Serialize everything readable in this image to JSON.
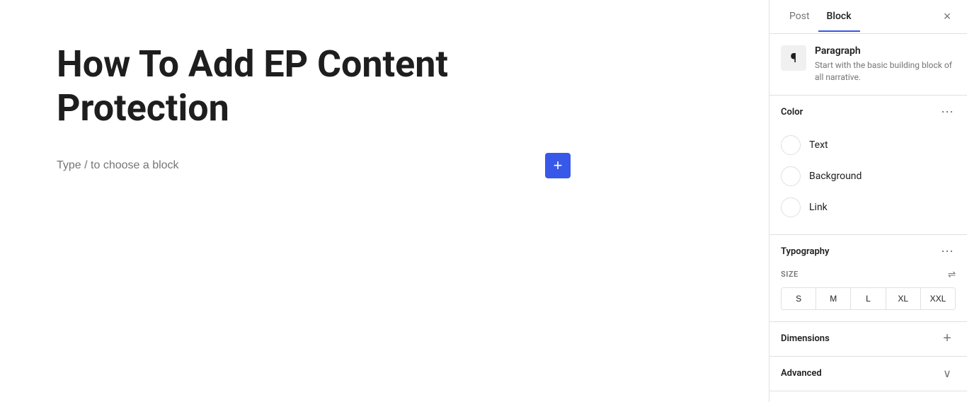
{
  "main": {
    "title": "How To Add EP Content Protection",
    "placeholder": "Type / to choose a block"
  },
  "sidebar": {
    "tabs": [
      {
        "label": "Post",
        "active": false
      },
      {
        "label": "Block",
        "active": true
      }
    ],
    "close_label": "×",
    "block_icon": "¶",
    "block_name": "Paragraph",
    "block_desc": "Start with the basic building block of all narrative.",
    "color_section": {
      "title": "Color",
      "options": [
        {
          "label": "Text"
        },
        {
          "label": "Background"
        },
        {
          "label": "Link"
        }
      ]
    },
    "typography_section": {
      "title": "Typography",
      "size_label": "SIZE",
      "sizes": [
        {
          "label": "S",
          "active": false
        },
        {
          "label": "M",
          "active": false
        },
        {
          "label": "L",
          "active": false
        },
        {
          "label": "XL",
          "active": false
        },
        {
          "label": "XXL",
          "active": false
        }
      ]
    },
    "dimensions_section": {
      "title": "Dimensions"
    },
    "advanced_section": {
      "title": "Advanced"
    }
  },
  "add_block_button_label": "+",
  "icons": {
    "three_dots": "···",
    "sliders": "⇌",
    "plus": "+",
    "chevron_down": "∨"
  }
}
